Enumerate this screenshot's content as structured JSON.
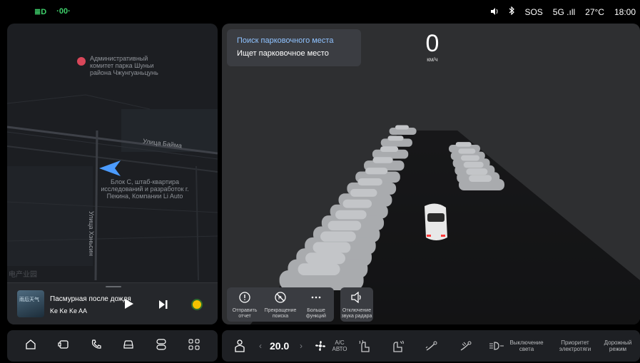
{
  "status_bar": {
    "left_icons": [
      "headlight-icon",
      "parking-light-icon"
    ],
    "left_glyphs": [
      "≣D",
      "·00·"
    ],
    "sos": "SOS",
    "network": "5G",
    "temperature": "27°C",
    "time": "18:00"
  },
  "map": {
    "poi_text": "Административный комитет парка Шуньи района Чжунгуаньцунь",
    "street_1": "Улица Байма",
    "street_2": "Улица Хэньсин",
    "location_text": "Блок С, штаб-квартира исследований и разработок г. Пекина, Компании Li Auto",
    "watermark": "电产业园"
  },
  "media": {
    "album_text": "雨后天气",
    "title": "Пасмурная после дождя",
    "artist": "Ke Ke Ke AA"
  },
  "parking": {
    "status_title": "Поиск парковочного места",
    "status_text": "Ищет парковочное место",
    "speed": "0",
    "speed_unit": "км/ч",
    "actions": [
      {
        "label": "Отправить отчет",
        "icon": "report-icon"
      },
      {
        "label": "Прекращение поиска",
        "icon": "stop-search-icon"
      },
      {
        "label": "Больше функций",
        "icon": "more-icon"
      }
    ],
    "mute_label": "Отключение звука радара"
  },
  "dock_left": [
    "home-icon",
    "screen-icon",
    "phone-icon",
    "car-icon",
    "toggle-icon",
    "apps-icon"
  ],
  "climate": {
    "temperature": "20.0",
    "ac_label": "A/C",
    "auto_label": "АВТО",
    "light_off_label": "Выключение света",
    "priority_label": "Приоритет электротяги",
    "road_mode_label": "Дорожный режим"
  }
}
